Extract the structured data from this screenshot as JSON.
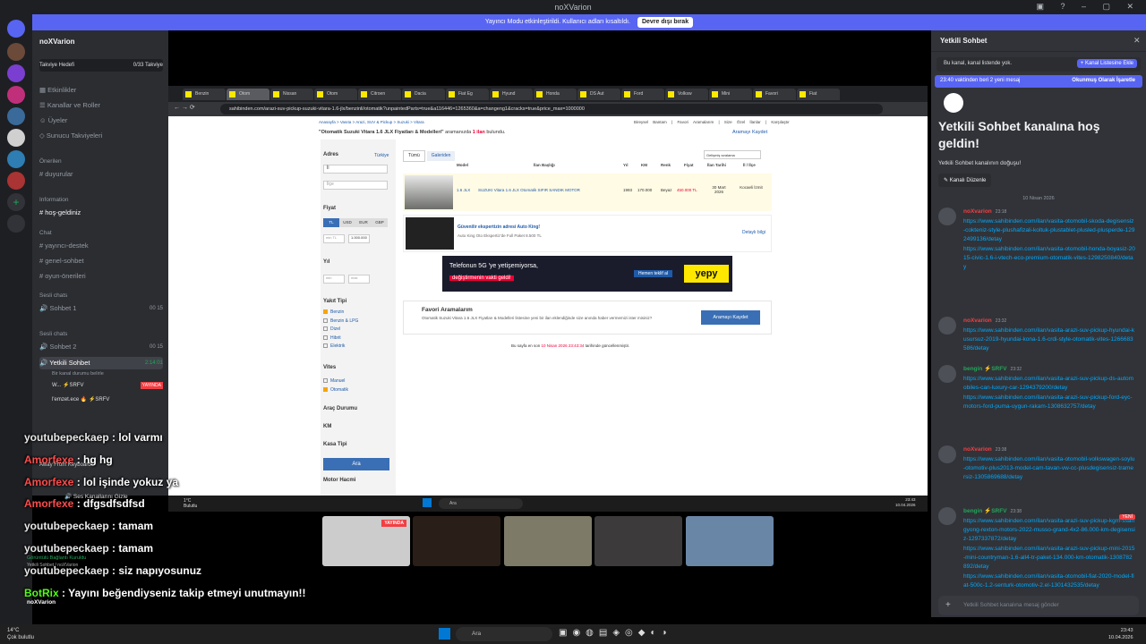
{
  "window": {
    "title": "noXVarion"
  },
  "banner": {
    "text": "Yayıncı Modu etkinleştirildi. Kullanıcı adları kısaltıldı.",
    "button": "Devre dışı bırak"
  },
  "server": {
    "name": "noXVarion",
    "boost_label": "Takviye Hedefi",
    "boost_count": "0/33 Takviye"
  },
  "sidebar": {
    "menu": [
      "Etkinlikler",
      "Kanallar ve Roller",
      "Üyeler",
      "Sunucu Takviyeleri"
    ],
    "cat_featured": "Önerilen",
    "featured_channel": "duyurular",
    "cat_info": "Information",
    "info_channel": "hoş-geldiniz",
    "cat_chat": "Chat",
    "chat_channels": [
      "yayıncı-destek",
      "genel-sohbet",
      "oyun-önerileri"
    ],
    "cat_voice1": "Sesli chats",
    "voice1": "Sohbet 1",
    "voice1_badge": "00  15",
    "cat_voice2": "Sesli chats",
    "voice2": "Sohbet 2",
    "voice2_badge": "00  15",
    "active_voice": "Yetkili Sohbet",
    "active_time": "2:14:01",
    "active_status": "Bir kanal durumu belirle",
    "voice_users": [
      "W... ⚡SRFV",
      "l'emzet.ece 🔥 ⚡SRFV",
      "bengin ⚡SRFV"
    ],
    "live_badge": "YAYINDA",
    "footer_user": "noXVarion",
    "voice_connected": "Görüntülü Bağlantı Kuruldu",
    "voice_sub": "Yetkili Sohbet / noXVarion"
  },
  "browser": {
    "tabs": [
      "Benzin",
      "Otom",
      "Nissan",
      "Otom",
      "Citroen",
      "Dacia",
      "Fiat Eg",
      "Hyund",
      "Honda",
      "DS Aut",
      "Ford",
      "Volksw",
      "Mini",
      "Favori",
      "Fiat"
    ],
    "url": "sahibinden.com/arazi-suv-pickup-suzuki-vitara-1.6-jlx/benzinli/otomatik?unpaintedParts=true&a116446=1265360&a=changeng1&cracks=true&price_max=1000000"
  },
  "listing": {
    "header_links": [
      "Bireysel Bantam",
      "Favori Aramalarım",
      "Size Özel İlanlar",
      "Karşılaştır"
    ],
    "breadcrumb": "Anasayfa  >  Vasıta  >  Arazi, SUV & Pickup  >  Suzuki  >  Vitara",
    "search_info_pre": "\"Otomatik Suzuki Vitara 1.6 JLX Fiyatları & Modelleri\"",
    "search_info_mid": "aramanızda",
    "search_info_count": "1 ilan",
    "search_info_post": "bulundu.",
    "save_search": "Aramayı Kaydet",
    "filters": {
      "address": "Adres",
      "country": "Türkiye",
      "il": "İl",
      "ilce": "İlçe",
      "price": "Fiyat",
      "currencies": [
        "TL",
        "USD",
        "EUR",
        "GBP"
      ],
      "min": "min TL",
      "max": "1.000.000",
      "year": "Yıl",
      "min_y": "min",
      "max_y": "max",
      "fuel": "Yakıt Tipi",
      "fuels": [
        "Benzin",
        "Benzin & LPG",
        "Dizel",
        "Hibrit",
        "Elektrik"
      ],
      "gear": "Vites",
      "gears": [
        "Manuel",
        "Otomatik"
      ],
      "condition": "Araç Durumu",
      "km": "KM",
      "body": "Kasa Tipi",
      "search_btn": "Ara",
      "engine": "Motor Hacmi"
    },
    "tabs": [
      "Tümü",
      "Galeriden"
    ],
    "sort": "Gelişmiş sıralama",
    "columns": [
      "Model",
      "İlan Başlığı",
      "Yıl",
      "KM",
      "Renk",
      "Fiyat",
      "İlan Tarihi",
      "İl / İlçe"
    ],
    "row": {
      "model": "1.6 JLX",
      "title": "SUZUKI Vitara 1.6 JLX Otomatik SIFIR SANDIK MOTOR",
      "year": "1993",
      "km": "170.000",
      "color": "Beyaz",
      "price": "450.000 TL",
      "date": "30 Mart 2026",
      "loc": "Kocaeli İzmit"
    },
    "ad": {
      "title": "Güvenilir ekspertizin adresi Auto King!",
      "sub": "Auto King Oto Ekspertiz'de Full Paket 8.500 TL",
      "link": "Detaylı bilgi"
    },
    "banner_ad": {
      "text1": "Telefonun 5G 'ye yetişemiyorsa,",
      "text2": "değiştirmenin vakti geldi!",
      "btn": "Hemen teklif al",
      "brand": "yepy"
    },
    "favorite": {
      "title": "Favori Aramalarım",
      "body": "Otomatik Suzuki Vitara 1.6 JLX Fiyatları & Modelleri listesine yeni bir ilan eklendiğinde size anında haber vermemizi ister misiniz?",
      "btn": "Aramayı Kaydet"
    },
    "updated_pre": "Bu sayfa en son",
    "updated_date": "10 Nisan 2026 23:43:34",
    "updated_post": "tarihinde güncellenmiştir."
  },
  "right": {
    "title": "Yetkili Sohbet",
    "not_listed": "Bu kanal, kanal listende yok.",
    "add_btn": "+ Kanal Listesine Ekle",
    "new_msgs": "23:40 vaktinden beri 2 yeni mesaj",
    "mark_read": "Okunmuş Olarak İşaretle",
    "welcome": "Yetkili Sohbet kanalına hoş geldin!",
    "welcome_sub": "Yetkili Sohbet kanalının doğuşu!",
    "edit_btn": "Kanalı Düzenle",
    "date_div": "10 Nisan 2026",
    "messages": [
      {
        "user": "noXvarion",
        "time": "23:18",
        "color": "#f23f43",
        "links": [
          "https://www.sahibinden.com/ilan/vasita-otomobil-skoda-degisensiz-cokteniz-style-plushafizali-koltuk-plustablet-plusled-plusperde-1292499136/detay",
          "https://www.sahibinden.com/ilan/vasita-otomobil-honda-boyasiz-2015-civic-1.6-i-vtech-eco-premium-otomatik-vites-1298250840/detay"
        ]
      },
      {
        "user": "noXvarion",
        "time": "23:32",
        "color": "#f23f43",
        "links": [
          "https://www.sahibinden.com/ilan/vasita-arazi-suv-pickup-hyundai-kusursuz-2019-hyundai-kona-1.6-crdi-style-otomatik-vites-1266683586/detay"
        ]
      },
      {
        "user": "bengin ⚡SRFV",
        "time": "23:32",
        "color": "#23a55a",
        "links": [
          "https://www.sahibinden.com/ilan/vasita-arazi-suv-pickup-ds-automobiles-can-luxury-car-1294379200/detay",
          "https://www.sahibinden.com/ilan/vasita-arazi-suv-pickup-ford-eyc-motors-ford-puma-uygun-rakam-1308632757/detay"
        ]
      },
      {
        "user": "noXvarion",
        "time": "23:38",
        "color": "#f23f43",
        "links": [
          "https://www.sahibinden.com/ilan/vasita-otomobil-volkswagen-soylu-otomotiv-plus2013-model-cam-tavan-vw-cc-plusdegisensiz-tramersiz-1305869688/detay"
        ]
      },
      {
        "user": "bengin ⚡SRFV",
        "time": "23:38",
        "color": "#23a55a",
        "links": [
          "https://www.sahibinden.com/ilan/vasita-arazi-suv-pickup-kgm-ssangyong-rexton-motors-2022-musso-grand-4x2-86.000-km-degisensiz-1297337872/detay",
          "https://www.sahibinden.com/ilan/vasita-arazi-suv-pickup-mini-2015-mini-countryman-1.6-all4-tr-paket-134.000-km-otomatik-1308782892/detay",
          "https://www.sahibinden.com/ilan/vasita-otomobil-fiat-2020-model-fiat-500c-1.2-senturk-otomotiv-2.el-1301432535/detay"
        ]
      }
    ],
    "new_badge": "YENİ",
    "input_placeholder": "Yetkili Sohbet kanalına mesaj gönder"
  },
  "overlay_chat": [
    {
      "user": "youtubepeckaep",
      "text": " : lol varmı",
      "color": "#e8e8e8"
    },
    {
      "user": "Amorfexe",
      "text": " : hg hg",
      "color": "#ff4b4b"
    },
    {
      "user": "Amorfexe",
      "text": " : lol işinde yokuz ya",
      "color": "#ff4b4b"
    },
    {
      "user": "Amorfexe",
      "text": " : dfgsdfsdfsd",
      "color": "#ff4b4b"
    },
    {
      "user": "youtubepeckaep",
      "text": " : tamam",
      "color": "#e8e8e8"
    },
    {
      "user": "youtubepeckaep",
      "text": " : tamam",
      "color": "#e8e8e8"
    },
    {
      "user": "youtubepeckaep",
      "text": " : siz napıyosunuz",
      "color": "#e8e8e8"
    },
    {
      "user": "BotRix",
      "text": " : Yayını beğendiyseniz takip etmeyi unutmayın!!",
      "color": "#53fc18"
    }
  ],
  "overlay_misc": {
    "away": "Away From Keyboard",
    "voice_channels": "Ses Kanallarını Gizle",
    "weather": "1°C",
    "weather_sub": "Bulutlu"
  },
  "win_taskbar": {
    "temp": "14°C",
    "cond": "Çok bulutlu",
    "search": "Ara",
    "time": "23:43",
    "date": "10.04.2026"
  },
  "inner_taskbar": {
    "search": "Ara",
    "time": "23:43",
    "date": "10.04.2026"
  },
  "stream_live": "YAYINDA"
}
